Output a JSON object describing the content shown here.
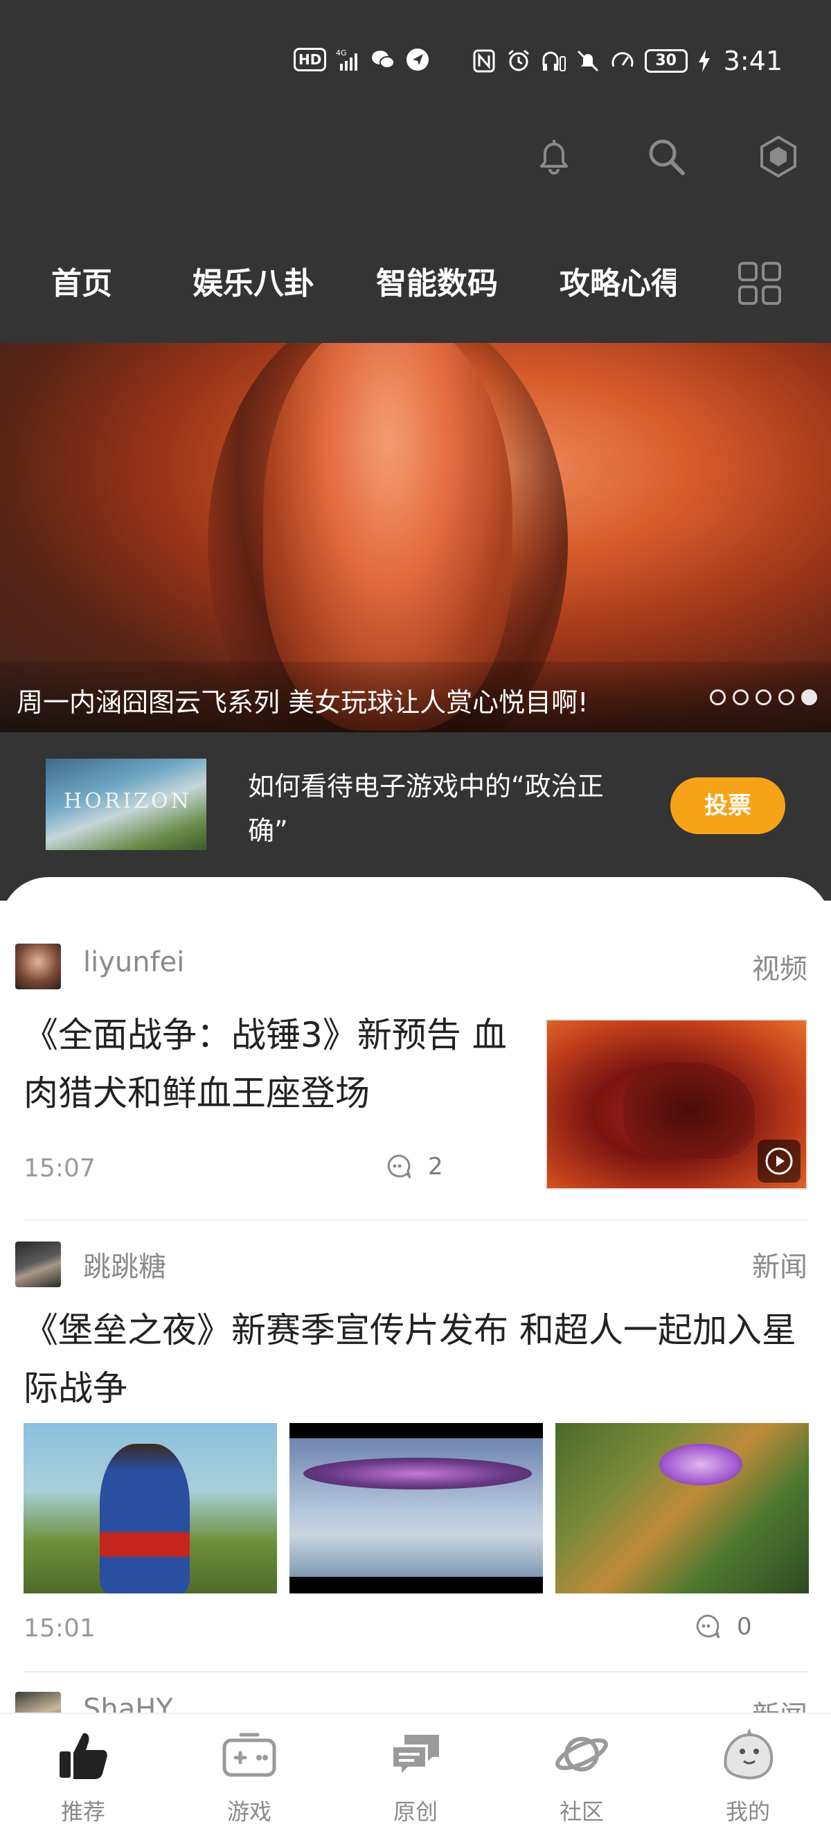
{
  "status_bar": {
    "hd_badge": "HD",
    "network": "4G",
    "battery": "30",
    "time": "3:41"
  },
  "header": {
    "icons": [
      "bell-icon",
      "search-icon",
      "hexagon-settings-icon"
    ]
  },
  "tabs": [
    {
      "label": "首页"
    },
    {
      "label": "娱乐八卦"
    },
    {
      "label": "智能数码"
    },
    {
      "label": "攻略心得"
    }
  ],
  "banner": {
    "caption": "周一内涵囧图云飞系列 美女玩球让人赏心悦目啊!",
    "slide_count": 5,
    "active_index": 4
  },
  "poll": {
    "thumb_text": "HORIZON",
    "question": "如何看待电子游戏中的“政治正确”",
    "vote_label": "投票"
  },
  "feed": [
    {
      "author": "liyunfei",
      "type": "视频",
      "title": "《全面战争：战锤3》新预告 血肉猎犬和鲜血王座登场",
      "time": "15:07",
      "comments": "2"
    },
    {
      "author": "跳跳糖",
      "type": "新闻",
      "title": "《堡垒之夜》新赛季宣传片发布 和超人一起加入星际战争",
      "time": "15:01",
      "comments": "0"
    },
    {
      "author": "ShaHY",
      "type": "新闻"
    }
  ],
  "bottom_nav": [
    {
      "label": "推荐",
      "icon": "thumbs-up-icon"
    },
    {
      "label": "游戏",
      "icon": "gamepad-icon"
    },
    {
      "label": "原创",
      "icon": "chat-bubbles-icon"
    },
    {
      "label": "社区",
      "icon": "planet-icon"
    },
    {
      "label": "我的",
      "icon": "mascot-icon"
    }
  ],
  "colors": {
    "header_bg": "#343434",
    "accent": "#f7a318",
    "text_gray": "#8a8a8a"
  }
}
